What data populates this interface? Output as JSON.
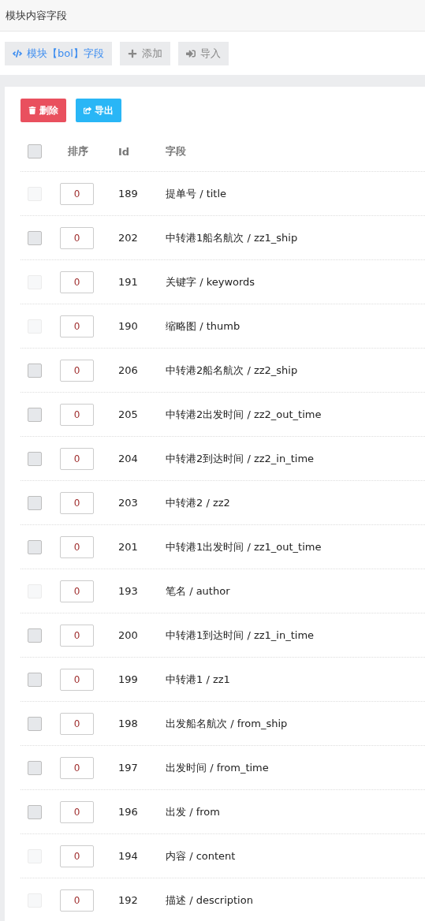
{
  "page_title": "模块内容字段",
  "toolbar": [
    {
      "kind": "code",
      "label": "模块【bol】字段",
      "selected": true
    },
    {
      "kind": "add",
      "label": "添加",
      "selected": false
    },
    {
      "kind": "import",
      "label": "导入",
      "selected": false
    }
  ],
  "actions": [
    {
      "kind": "delete",
      "label": "删除"
    },
    {
      "kind": "export",
      "label": "导出"
    }
  ],
  "table": {
    "select_all": {
      "checked": false
    },
    "columns": [
      "排序",
      "Id",
      "字段"
    ],
    "rows": [
      {
        "order": "0",
        "id": "189",
        "field": "提单号 / title",
        "disabled": true
      },
      {
        "order": "0",
        "id": "202",
        "field": "中转港1船名航次 / zz1_ship",
        "disabled": false
      },
      {
        "order": "0",
        "id": "191",
        "field": "关键字 / keywords",
        "disabled": true
      },
      {
        "order": "0",
        "id": "190",
        "field": "缩略图 / thumb",
        "disabled": true
      },
      {
        "order": "0",
        "id": "206",
        "field": "中转港2船名航次 / zz2_ship",
        "disabled": false
      },
      {
        "order": "0",
        "id": "205",
        "field": "中转港2出发时间 / zz2_out_time",
        "disabled": false
      },
      {
        "order": "0",
        "id": "204",
        "field": "中转港2到达时间 / zz2_in_time",
        "disabled": false
      },
      {
        "order": "0",
        "id": "203",
        "field": "中转港2 / zz2",
        "disabled": false
      },
      {
        "order": "0",
        "id": "201",
        "field": "中转港1出发时间 / zz1_out_time",
        "disabled": false
      },
      {
        "order": "0",
        "id": "193",
        "field": "笔名 / author",
        "disabled": true
      },
      {
        "order": "0",
        "id": "200",
        "field": "中转港1到达时间 / zz1_in_time",
        "disabled": false
      },
      {
        "order": "0",
        "id": "199",
        "field": "中转港1 / zz1",
        "disabled": false
      },
      {
        "order": "0",
        "id": "198",
        "field": "出发船名航次 / from_ship",
        "disabled": false
      },
      {
        "order": "0",
        "id": "197",
        "field": "出发时间 / from_time",
        "disabled": false
      },
      {
        "order": "0",
        "id": "196",
        "field": "出发 / from",
        "disabled": false
      },
      {
        "order": "0",
        "id": "194",
        "field": "内容 / content",
        "disabled": true
      },
      {
        "order": "0",
        "id": "192",
        "field": "描述 / description",
        "disabled": true
      }
    ]
  }
}
